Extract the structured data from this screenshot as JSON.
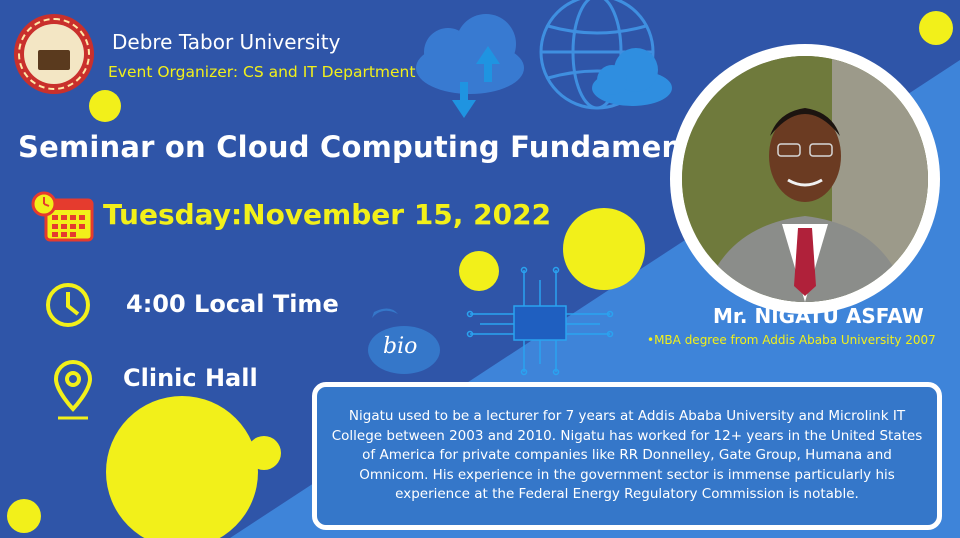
{
  "colors": {
    "background_dark": "#2f55a8",
    "background_light": "#3e84d9",
    "accent_yellow": "#f2f01a",
    "text_white": "#ffffff"
  },
  "header": {
    "university": "Debre Tabor University",
    "organizer": "Event Organizer: CS and IT Department"
  },
  "event": {
    "title": "Seminar on Cloud Computing Fundamentals",
    "date": "Tuesday:November 15, 2022",
    "time": "4:00 Local Time",
    "location": "Clinic Hall"
  },
  "speaker": {
    "name": "Mr. NIGATU ASFAW",
    "degree": "•MBA degree from Addis Ababa University 2007",
    "bio_label": "bio",
    "bio": "Nigatu used to be a lecturer for 7 years at Addis Ababa University and Microlink IT College between 2003 and 2010. Nigatu has worked for 12+ years in the United States of America for private companies like RR Donnelley, Gate Group, Humana and Omnicom. His experience in the government sector is immense particularly his experience at the Federal Energy Regulatory Commission is notable."
  },
  "icons": [
    "university-logo-icon",
    "cloud-upload-icon",
    "globe-cloud-icon",
    "calendar-clock-icon",
    "clock-icon",
    "location-pin-icon",
    "chip-icon",
    "speaker-photo"
  ]
}
